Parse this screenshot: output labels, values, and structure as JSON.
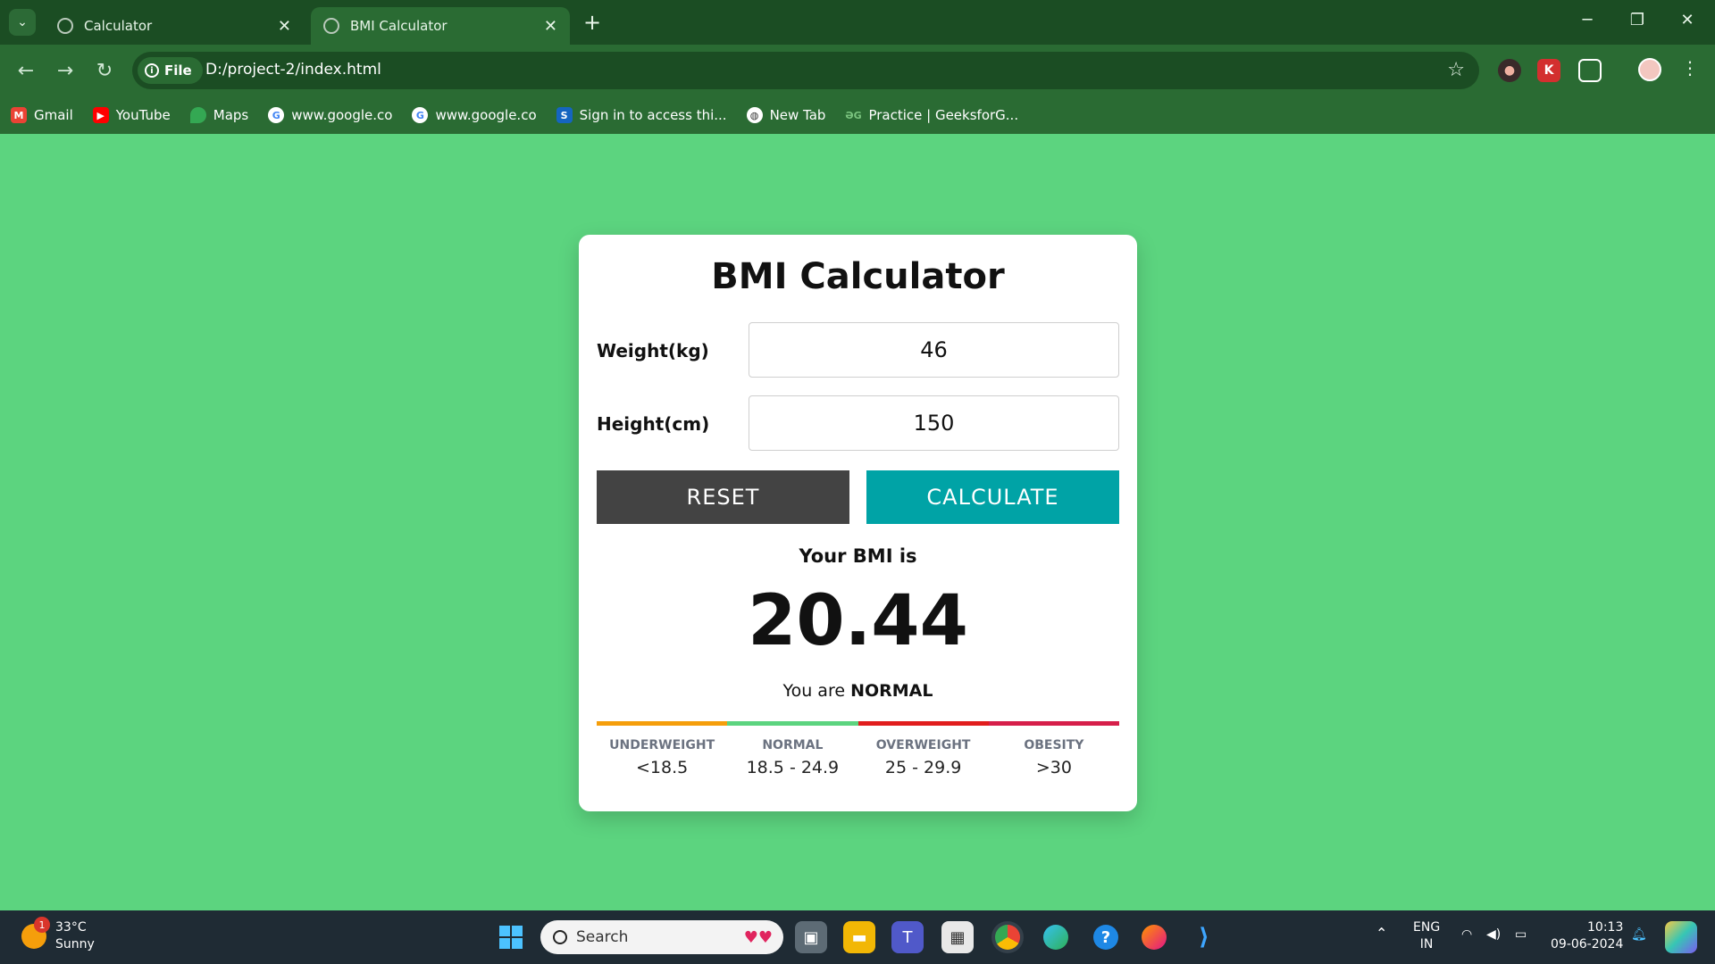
{
  "browser": {
    "tabs": [
      {
        "title": "Calculator",
        "active": false
      },
      {
        "title": "BMI Calculator",
        "active": true
      }
    ],
    "omnibox": {
      "chip": "File",
      "url": "D:/project-2/index.html"
    },
    "bookmarks": [
      {
        "label": "Gmail",
        "icon": "gmail-icon",
        "color": "#ea4335"
      },
      {
        "label": "YouTube",
        "icon": "youtube-icon",
        "color": "#ff0000"
      },
      {
        "label": "Maps",
        "icon": "maps-icon",
        "color": "#34a853"
      },
      {
        "label": "www.google.co",
        "icon": "google-icon",
        "color": "#4285f4"
      },
      {
        "label": "www.google.co",
        "icon": "google-icon",
        "color": "#4285f4"
      },
      {
        "label": "Sign in to access thi...",
        "icon": "s-icon",
        "color": "#1565c0"
      },
      {
        "label": "New Tab",
        "icon": "globe-icon",
        "color": "#5f6368"
      },
      {
        "label": "Practice | GeeksforG...",
        "icon": "gfg-icon",
        "color": "#2f8d46"
      }
    ]
  },
  "page": {
    "title": "BMI Calculator",
    "weight_label": "Weight(kg)",
    "weight_value": "46",
    "height_label": "Height(cm)",
    "height_value": "150",
    "reset_label": "RESET",
    "calculate_label": "CALCULATE",
    "result_heading": "Your BMI is",
    "bmi_value": "20.44",
    "status_prefix": "You are",
    "status": "NORMAL",
    "scale": [
      {
        "name": "UNDERWEIGHT",
        "range": "<18.5",
        "color": "#f59e0b"
      },
      {
        "name": "NORMAL",
        "range": "18.5 - 24.9",
        "color": "#5cd47f"
      },
      {
        "name": "OVERWEIGHT",
        "range": "25 - 29.9",
        "color": "#e11d1d"
      },
      {
        "name": "OBESITY",
        "range": ">30",
        "color": "#d61f4a"
      }
    ],
    "colors": {
      "background": "#5cd47f",
      "reset": "#434343",
      "calculate": "#00a3a6"
    }
  },
  "taskbar": {
    "weather": {
      "temp": "33°C",
      "condition": "Sunny",
      "badge": "1"
    },
    "search_placeholder": "Search",
    "language": {
      "line1": "ENG",
      "line2": "IN"
    },
    "time": "10:13",
    "date": "09-06-2024"
  }
}
